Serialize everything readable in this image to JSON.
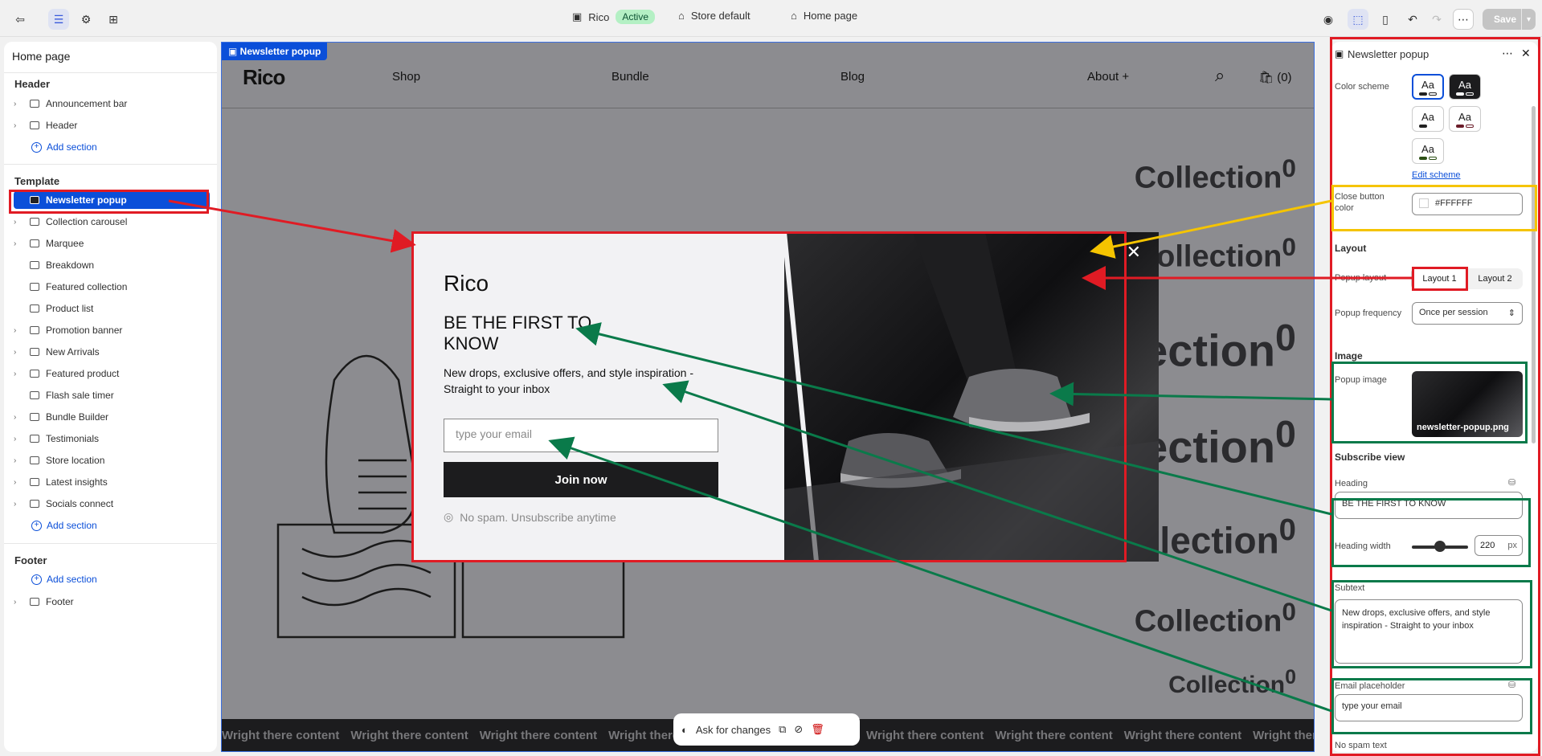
{
  "topbar": {
    "store_name": "Rico",
    "status_badge": "Active",
    "store_default": "Store default",
    "page": "Home page",
    "save_label": "Save"
  },
  "sidebar": {
    "page_title": "Home page",
    "header_title": "Header",
    "header_items": [
      "Announcement bar",
      "Header"
    ],
    "add_section": "Add section",
    "template_title": "Template",
    "template_items": [
      "Newsletter popup",
      "Collection carousel",
      "Marquee",
      "Breakdown",
      "Featured collection",
      "Product list",
      "Promotion banner",
      "New Arrivals",
      "Featured product",
      "Flash sale timer",
      "Bundle Builder",
      "Testimonials",
      "Store location",
      "Latest insights",
      "Socials connect"
    ],
    "footer_title": "Footer",
    "footer_items": [
      "Footer"
    ]
  },
  "preview": {
    "tag": "Newsletter popup",
    "logo": "Rico",
    "nav": [
      "Shop",
      "Bundle",
      "Blog",
      "About +"
    ],
    "cart": "(0)",
    "collection_word": "Collection",
    "collection_sup": "0",
    "marquee_text": "Wright there content",
    "ask_label": "Ask for changes"
  },
  "popup": {
    "logo": "Rico",
    "heading": "BE THE FIRST TO KNOW",
    "subtext": "New drops, exclusive offers, and style inspiration - Straight to your inbox",
    "email_placeholder": "type your email",
    "button": "Join now",
    "no_spam": "No spam. Unsubscribe anytime"
  },
  "settings": {
    "title": "Newsletter popup",
    "color_scheme_label": "Color scheme",
    "swatch_text": "Aa",
    "edit_scheme": "Edit scheme",
    "close_color_label": "Close button color",
    "close_color_value": "#FFFFFF",
    "layout_title": "Layout",
    "popup_layout_label": "Popup layout",
    "layout_options": [
      "Layout 1",
      "Layout 2"
    ],
    "frequency_label": "Popup frequency",
    "frequency_value": "Once per session",
    "image_title": "Image",
    "popup_image_label": "Popup image",
    "image_filename": "newsletter-popup.png",
    "subscribe_title": "Subscribe view",
    "heading_label": "Heading",
    "heading_value": "BE THE FIRST TO KNOW",
    "heading_width_label": "Heading width",
    "heading_width_value": "220",
    "heading_width_unit": "px",
    "subtext_label": "Subtext",
    "subtext_value": "New drops, exclusive offers, and style inspiration - Straight to your inbox",
    "email_placeholder_label": "Email placeholder",
    "email_placeholder_value": "type your email",
    "no_spam_label": "No spam text"
  },
  "colors": {
    "accent": "#0b4fd9",
    "annotation_red": "#e01b24",
    "annotation_green": "#0a7a4a",
    "annotation_yellow": "#f5c400"
  }
}
